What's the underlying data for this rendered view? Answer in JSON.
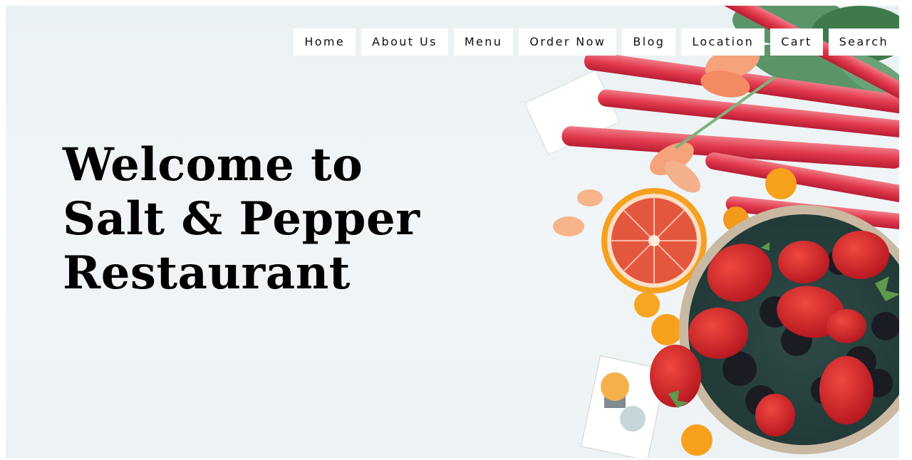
{
  "nav": {
    "items": [
      {
        "label": "Home"
      },
      {
        "label": "About Us"
      },
      {
        "label": "Menu"
      },
      {
        "label": "Order Now"
      },
      {
        "label": "Blog"
      },
      {
        "label": "Location"
      },
      {
        "label": "Cart"
      },
      {
        "label": "Search"
      }
    ]
  },
  "hero": {
    "headline_lines": [
      "Welcome to",
      "Salt & Pepper",
      "Restaurant"
    ]
  },
  "image": {
    "description_icon": "fruit-bowl-strawberries-rhubarb-photo"
  },
  "colors": {
    "background": "#eef4f6",
    "rhubarb": "#e43a4e",
    "strawberry": "#d9272e",
    "blackberry": "#1b1b24",
    "orange": "#f39a1d",
    "bowl": "#3b5a55"
  }
}
